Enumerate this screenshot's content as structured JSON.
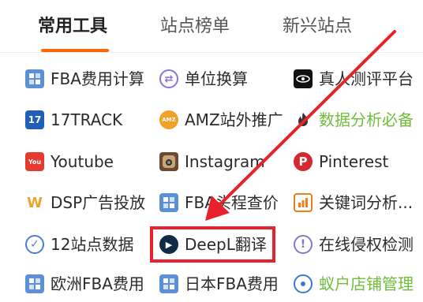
{
  "tabs": [
    {
      "label": "常用工具",
      "active": true
    },
    {
      "label": "站点榜单",
      "active": false
    },
    {
      "label": "新兴站点",
      "active": false
    }
  ],
  "tools": [
    {
      "label": "FBA费用计算",
      "icon": "calculator-icon",
      "color": "#5b8fd6"
    },
    {
      "label": "单位换算",
      "icon": "exchange-icon",
      "color": "#8a73d6"
    },
    {
      "label": "真人测评平台",
      "icon": "review-platform-logo-icon",
      "color": "#111111"
    },
    {
      "label": "17TRACK",
      "icon": "17track-logo-icon",
      "color": "#1f5fb7"
    },
    {
      "label": "AMZ站外推广",
      "icon": "amz-promo-logo-icon",
      "color": "#f0a12b"
    },
    {
      "label": "数据分析必备",
      "icon": "fire-icon",
      "color": "#333333",
      "highlight_text": true
    },
    {
      "label": "Youtube",
      "icon": "youtube-icon",
      "color": "#e33c2f"
    },
    {
      "label": "Instagram",
      "icon": "instagram-icon",
      "color": "#6b4a2f"
    },
    {
      "label": "Pinterest",
      "icon": "pinterest-icon",
      "color": "#d7262d"
    },
    {
      "label": "DSP广告投放",
      "icon": "dsp-logo-icon",
      "color": "#e9a62b"
    },
    {
      "label": "FBA头程查价",
      "icon": "calculator-icon",
      "color": "#5b8fd6"
    },
    {
      "label": "关键词分析...",
      "icon": "keyword-chart-icon",
      "color": "#ef7d1c"
    },
    {
      "label": "12站点数据",
      "icon": "check-shield-icon",
      "color": "#4b7fd0"
    },
    {
      "label": "DeepL翻译",
      "icon": "deepl-logo-icon",
      "color": "#0f2b46"
    },
    {
      "label": "在线侵权检测",
      "icon": "alert-circle-icon",
      "color": "#8a73d6"
    },
    {
      "label": "欧洲FBA费用",
      "icon": "calculator-icon",
      "color": "#5b8fd6"
    },
    {
      "label": "日本FBA费用",
      "icon": "calculator-icon",
      "color": "#5b8fd6"
    },
    {
      "label": "蚁户店铺管理",
      "icon": "ant-store-icon",
      "color": "#3a7bd5",
      "highlight_text": true
    }
  ],
  "colors": {
    "accent": "#ff6a00",
    "highlight_box": "#e8222c",
    "arrow": "#e8222c",
    "green_text": "#6fbf3a"
  }
}
